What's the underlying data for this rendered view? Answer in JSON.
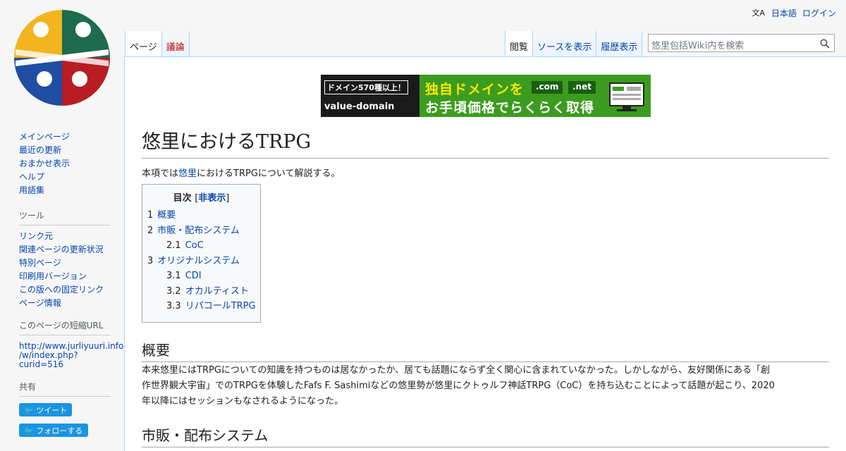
{
  "personal": {
    "lang_icon": "文A",
    "language": "日本語",
    "login": "ログイン"
  },
  "tabs": {
    "left": [
      {
        "label": "ページ",
        "state": "selected"
      },
      {
        "label": "議論",
        "state": "new"
      }
    ],
    "right": [
      {
        "label": "閲覧",
        "state": "selected"
      },
      {
        "label": "ソースを表示",
        "state": "link"
      },
      {
        "label": "履歴表示",
        "state": "link"
      }
    ]
  },
  "search": {
    "placeholder": "悠里包括Wiki内を検索",
    "icon": "search-icon"
  },
  "sidebar": {
    "nav": [
      "メインページ",
      "最近の更新",
      "おまかせ表示",
      "ヘルプ",
      "用語集"
    ],
    "tools_heading": "ツール",
    "tools": [
      "リンク元",
      "関連ページの更新状況",
      "特別ページ",
      "印刷用バージョン",
      "この版への固定リンク",
      "ページ情報"
    ],
    "short_url_heading": "このページの短縮URL",
    "short_url": [
      "http://www.jurliyuuri.info",
      "/w/index.php?",
      "curid=516"
    ],
    "share_heading": "共有",
    "tweet": "ツイート",
    "follow": "フォローする"
  },
  "banner": {
    "tag": "ドメイン570種以上！",
    "brand": "value-domain",
    "line1": "独自ドメインを",
    "line2": "お手頃価格でらくらく取得",
    "tld1": ".com",
    "tld2": ".net",
    "colors": {
      "bg": "#3b9c1f",
      "accent": "#ffe600"
    }
  },
  "page": {
    "title": "悠里におけるTRPG",
    "intro_prefix": "本項では",
    "intro_link": "悠里",
    "intro_suffix": "におけるTRPGについて解説する。"
  },
  "toc": {
    "title": "目次",
    "hide_open": "[",
    "hide": "非表示",
    "hide_close": "]",
    "items": [
      {
        "num": "1",
        "label": "概要"
      },
      {
        "num": "2",
        "label": "市販・配布システム"
      },
      {
        "num": "2.1",
        "label": "CoC"
      },
      {
        "num": "3",
        "label": "オリジナルシステム"
      },
      {
        "num": "3.1",
        "label": "CDI"
      },
      {
        "num": "3.2",
        "label": "オカルティスト"
      },
      {
        "num": "3.3",
        "label": "リパコールTRPG"
      }
    ]
  },
  "sections": {
    "overview_heading": "概要",
    "overview_lines": [
      "本来悠里にはTRPGについての知識を持つものは居なかったか、居ても話題にならず全く関心に含まれていなかった。しかしながら、友好関係にある「創",
      "作世界観大宇宙」でのTRPGを体験したFafs F. Sashimiなどの悠里勢が悠里にクトゥルフ神話TRPG（CoC）を持ち込むことによって話題が起こり、2020",
      "年以降にはセッションもなされるようになった。"
    ],
    "next_heading": "市販・配布システム"
  }
}
